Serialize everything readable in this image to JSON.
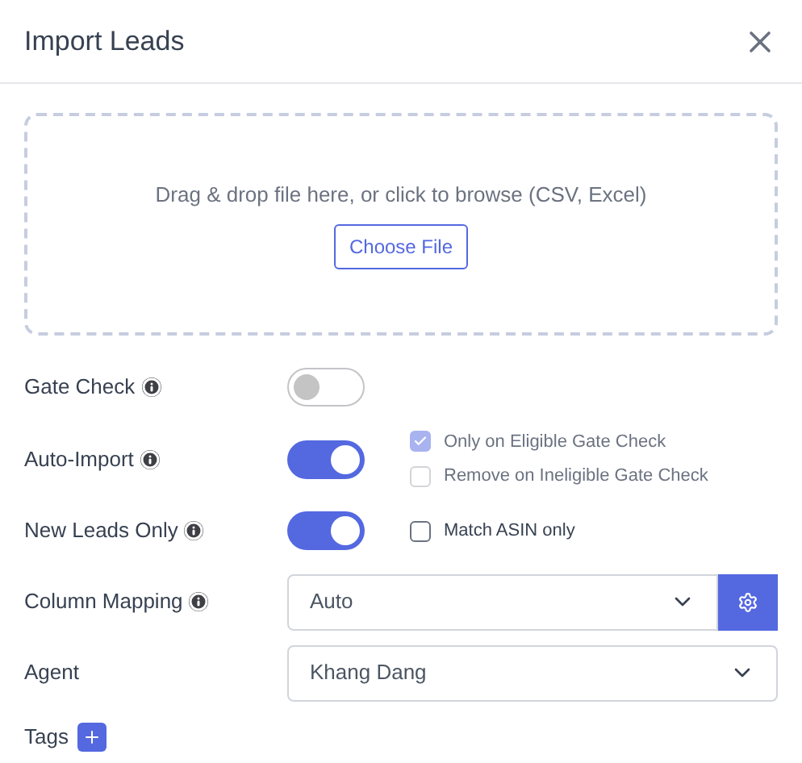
{
  "dialog": {
    "title": "Import Leads"
  },
  "dropzone": {
    "text": "Drag & drop file here, or click to browse (CSV, Excel)",
    "button": "Choose File"
  },
  "rows": [
    {
      "kind": "toggle",
      "label": "Gate Check",
      "info": true,
      "on": false,
      "options": []
    },
    {
      "kind": "toggle",
      "label": "Auto-Import",
      "info": true,
      "on": true,
      "options": [
        {
          "label": "Only on Eligible Gate Check",
          "checked": true,
          "disabled": true
        },
        {
          "label": "Remove on Ineligible Gate Check",
          "checked": false,
          "disabled": true
        }
      ]
    },
    {
      "kind": "toggle",
      "label": "New Leads Only",
      "info": true,
      "on": true,
      "options": [
        {
          "label": "Match ASIN only",
          "checked": false,
          "disabled": false
        }
      ]
    },
    {
      "kind": "select",
      "label": "Column Mapping",
      "info": true,
      "value": "Auto",
      "settings": true
    },
    {
      "kind": "select",
      "label": "Agent",
      "info": false,
      "value": "Khang Dang",
      "settings": false
    }
  ],
  "tags": {
    "label": "Tags"
  }
}
